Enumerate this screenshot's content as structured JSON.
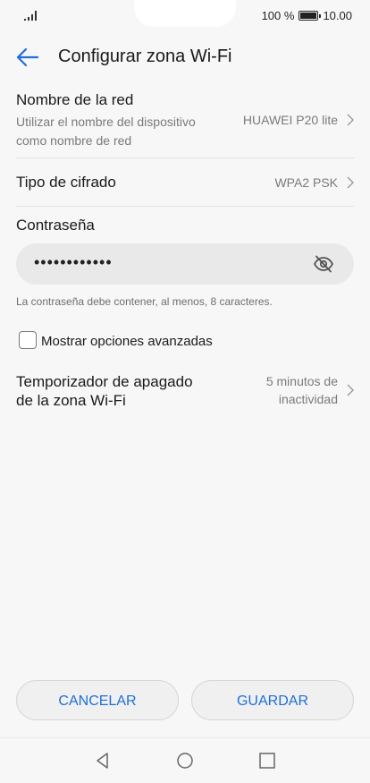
{
  "status_bar": {
    "battery_text": "100 %",
    "time": "10.00"
  },
  "header": {
    "title": "Configurar zona Wi-Fi"
  },
  "network_name": {
    "title": "Nombre de la red",
    "subtitle_line1": "Utilizar el nombre del dispositivo",
    "subtitle_line2": "como nombre de red",
    "value": "HUAWEI P20 lite"
  },
  "encryption": {
    "title": "Tipo de cifrado",
    "value": "WPA2 PSK"
  },
  "password": {
    "label": "Contraseña",
    "value": "••••••••••••",
    "hint": "La contraseña debe contener, al menos, 8 caracteres."
  },
  "advanced": {
    "label": "Mostrar opciones avanzadas",
    "checked": false
  },
  "timer": {
    "title_line1": "Temporizador de apagado",
    "title_line2": "de la zona Wi-Fi",
    "value_line1": "5 minutos de",
    "value_line2": "inactividad"
  },
  "buttons": {
    "cancel": "CANCELAR",
    "save": "GUARDAR"
  },
  "colors": {
    "accent": "#1e6fd9",
    "background": "#f7f7f7",
    "field": "#e9e9e9"
  },
  "icons": [
    "signal-icon",
    "battery-icon",
    "back-arrow-icon",
    "chevron-right-icon",
    "eye-off-icon",
    "nav-back-icon",
    "nav-home-icon",
    "nav-recents-icon"
  ]
}
